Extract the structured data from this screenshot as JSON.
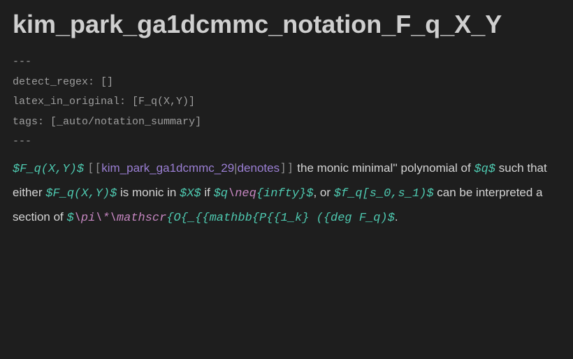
{
  "title": "kim_park_ga1dcmmc_notation_F_q_X_Y",
  "frontmatter": {
    "sep": "---",
    "lines": [
      {
        "key": "detect_regex",
        "value": "[]"
      },
      {
        "key": "latex_in_original",
        "value": "[F_q(X,Y)]"
      },
      {
        "key": "tags",
        "value": "[_auto/notation_summary]"
      }
    ]
  },
  "body": {
    "math1": "$F_q(X,Y)$",
    "link_open": "[[",
    "link_target": "kim_park_ga1dcmmc_29",
    "link_pipe": "|",
    "link_label": "denotes",
    "link_close": "]]",
    "text1": " the monic minimal'' polynomial of ",
    "math2": "$q$",
    "text2": " such that either ",
    "math3": "$F_q(X,Y)$",
    "text3": " is monic in ",
    "math4": "$X$",
    "text4": " if ",
    "math5_raw": "$q\\neq{infty}$",
    "text5": ", or ",
    "math6": "$f_q[s_0,s_1)$",
    "text6": " can be interpreted a section of ",
    "math7_raw": "$\\pi\\*\\mathscr{O{_{{mathbb{P{{1_k} ({deg F_q)$",
    "text7": "."
  }
}
